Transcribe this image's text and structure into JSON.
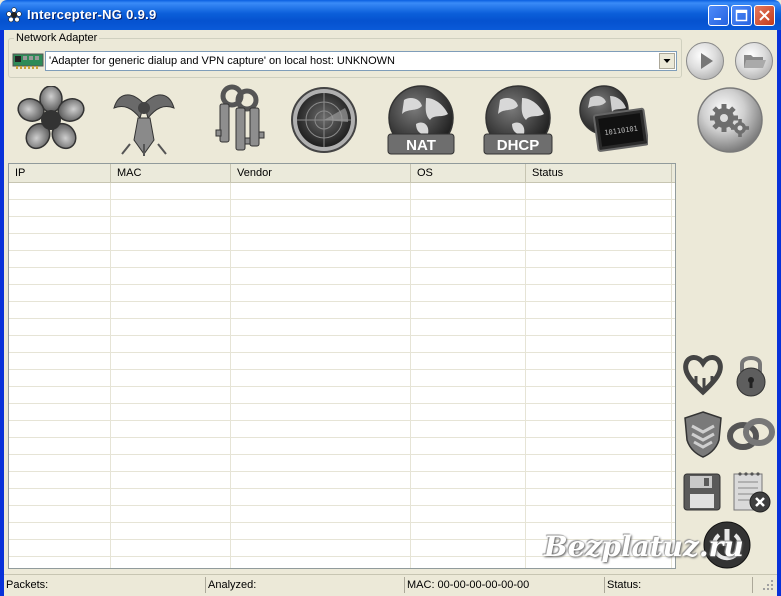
{
  "window": {
    "title": "Intercepter-NG 0.9.9"
  },
  "adapter": {
    "group_label": "Network Adapter",
    "selected": "'Adapter for generic dialup and VPN capture' on local host: UNKNOWN"
  },
  "toolbar": {
    "icons": [
      "flower-icon",
      "phoenix-icon",
      "keys-icon",
      "radar-icon",
      "nat-globe-icon",
      "dhcp-globe-icon",
      "network-terminal-icon",
      "settings-gear-icon"
    ],
    "nat_label": "NAT",
    "dhcp_label": "DHCP",
    "terminal_text": "10110101"
  },
  "table": {
    "columns": [
      "IP",
      "MAC",
      "Vendor",
      "OS",
      "Status"
    ],
    "rows": []
  },
  "side_icons": [
    "heartbleed-icon",
    "padlock-icon",
    "shield-icon",
    "rings-icon",
    "floppy-disk-icon",
    "clear-notepad-icon",
    "power-icon"
  ],
  "statusbar": {
    "packets": "Packets:",
    "analyzed": "Analyzed:",
    "mac": "MAC: 00-00-00-00-00-00",
    "status": "Status:"
  },
  "watermark": "Bezplatuz.ru",
  "colors": {
    "titlebar": "#0A5FE0",
    "window_bg": "#ECE9D8",
    "close_button": "#C33A1B"
  }
}
